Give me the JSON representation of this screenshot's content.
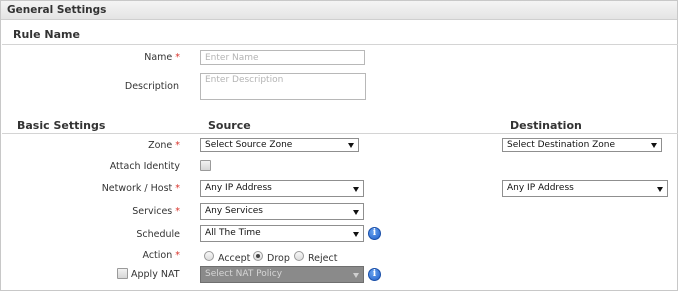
{
  "header": {
    "title": "General Settings"
  },
  "rule_name": {
    "title": "Rule Name",
    "name_label": "Name",
    "name_placeholder": "Enter Name",
    "description_label": "Description",
    "description_placeholder": "Enter Description"
  },
  "basic": {
    "title": "Basic Settings",
    "source_title": "Source",
    "destination_title": "Destination",
    "required_mark": "*",
    "zone_label": "Zone",
    "source_zone": "Select Source Zone",
    "destination_zone": "Select Destination Zone",
    "attach_identity_label": "Attach Identity",
    "network_label": "Network / Host",
    "source_network": "Any IP Address",
    "destination_network": "Any IP Address",
    "services_label": "Services",
    "services_value": "Any Services",
    "schedule_label": "Schedule",
    "schedule_value": "All The Time",
    "action_label": "Action",
    "action_options": [
      "Accept",
      "Drop",
      "Reject"
    ],
    "action_selected": "Drop",
    "apply_nat_label": "Apply NAT",
    "nat_policy_value": "Select NAT Policy",
    "info_glyph": "i"
  },
  "colors": {
    "required": "#d9342b",
    "info_icon": "#1f5fc9",
    "disabled_select": "#8a8a8a"
  }
}
